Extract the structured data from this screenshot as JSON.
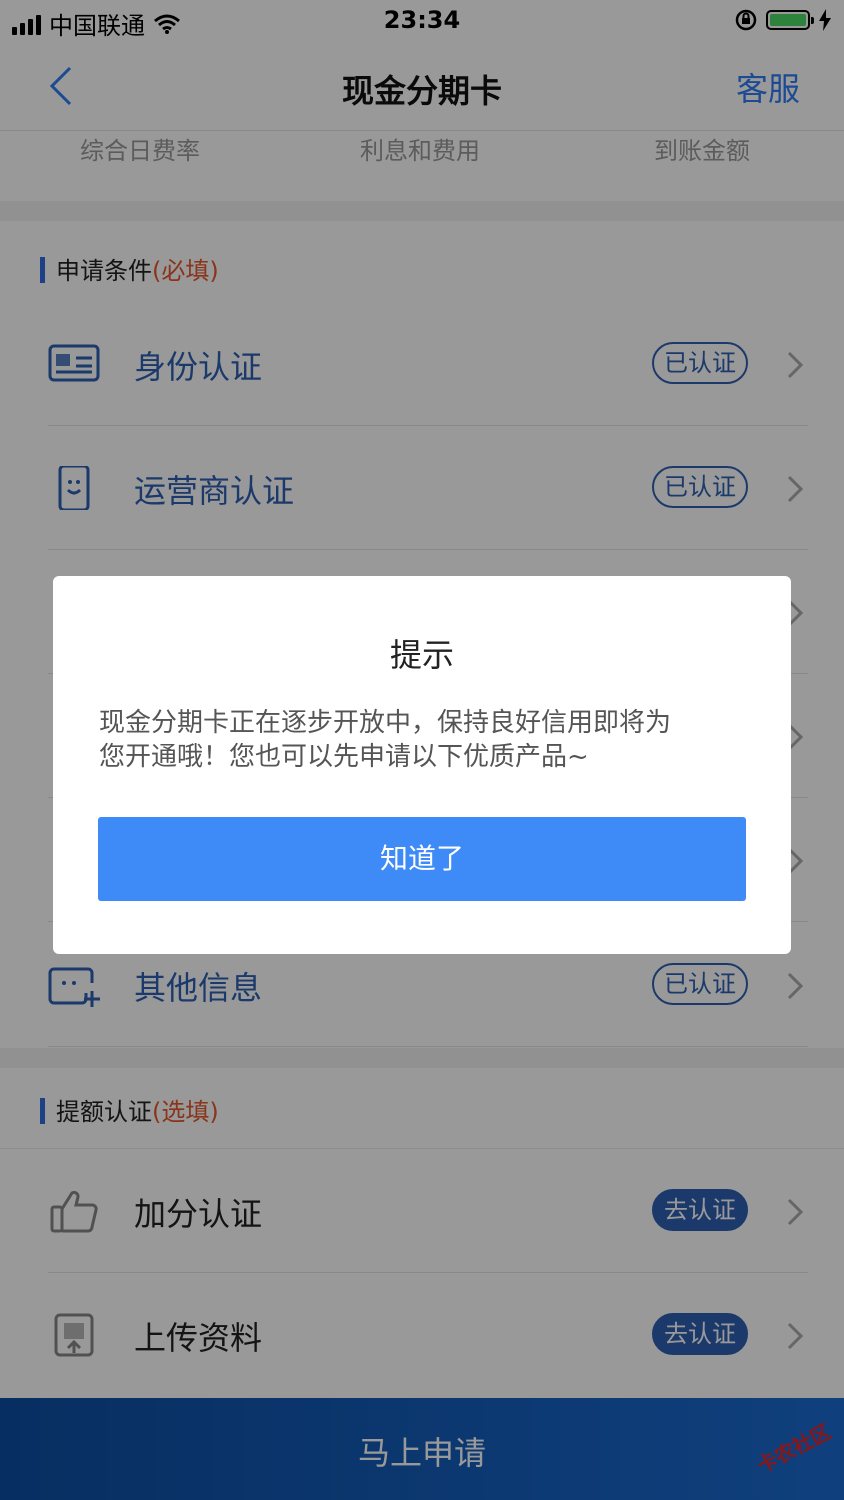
{
  "status_bar": {
    "carrier": "中国联通",
    "time": "23:34"
  },
  "nav": {
    "title": "现金分期卡",
    "service": "客服"
  },
  "summary": {
    "items": [
      "综合日费率",
      "利息和费用",
      "到账金额"
    ]
  },
  "required": {
    "title": "申请条件",
    "tag": "(必填)",
    "items": [
      {
        "label": "身份认证",
        "status": "已认证"
      },
      {
        "label": "运营商认证",
        "status": "已认证"
      },
      {
        "label": "其他信息",
        "status": "已认证"
      }
    ]
  },
  "optional": {
    "title": "提额认证",
    "tag": "(选填)",
    "items": [
      {
        "label": "加分认证",
        "status": "去认证"
      },
      {
        "label": "上传资料",
        "status": "去认证"
      }
    ]
  },
  "apply_button": "马上申请",
  "dialog": {
    "title": "提示",
    "line1": "现金分期卡正在逐步开放中，保持良好信用即将为",
    "line2": "您开通哦！您也可以先申请以下优质产品~",
    "button": "知道了"
  },
  "watermark": "卡农社区",
  "colors": {
    "accent": "#2f5fb3",
    "primary_button": "#3e8af7",
    "required_tag": "#e4572e",
    "apply_bar": "#1a6bd1"
  }
}
